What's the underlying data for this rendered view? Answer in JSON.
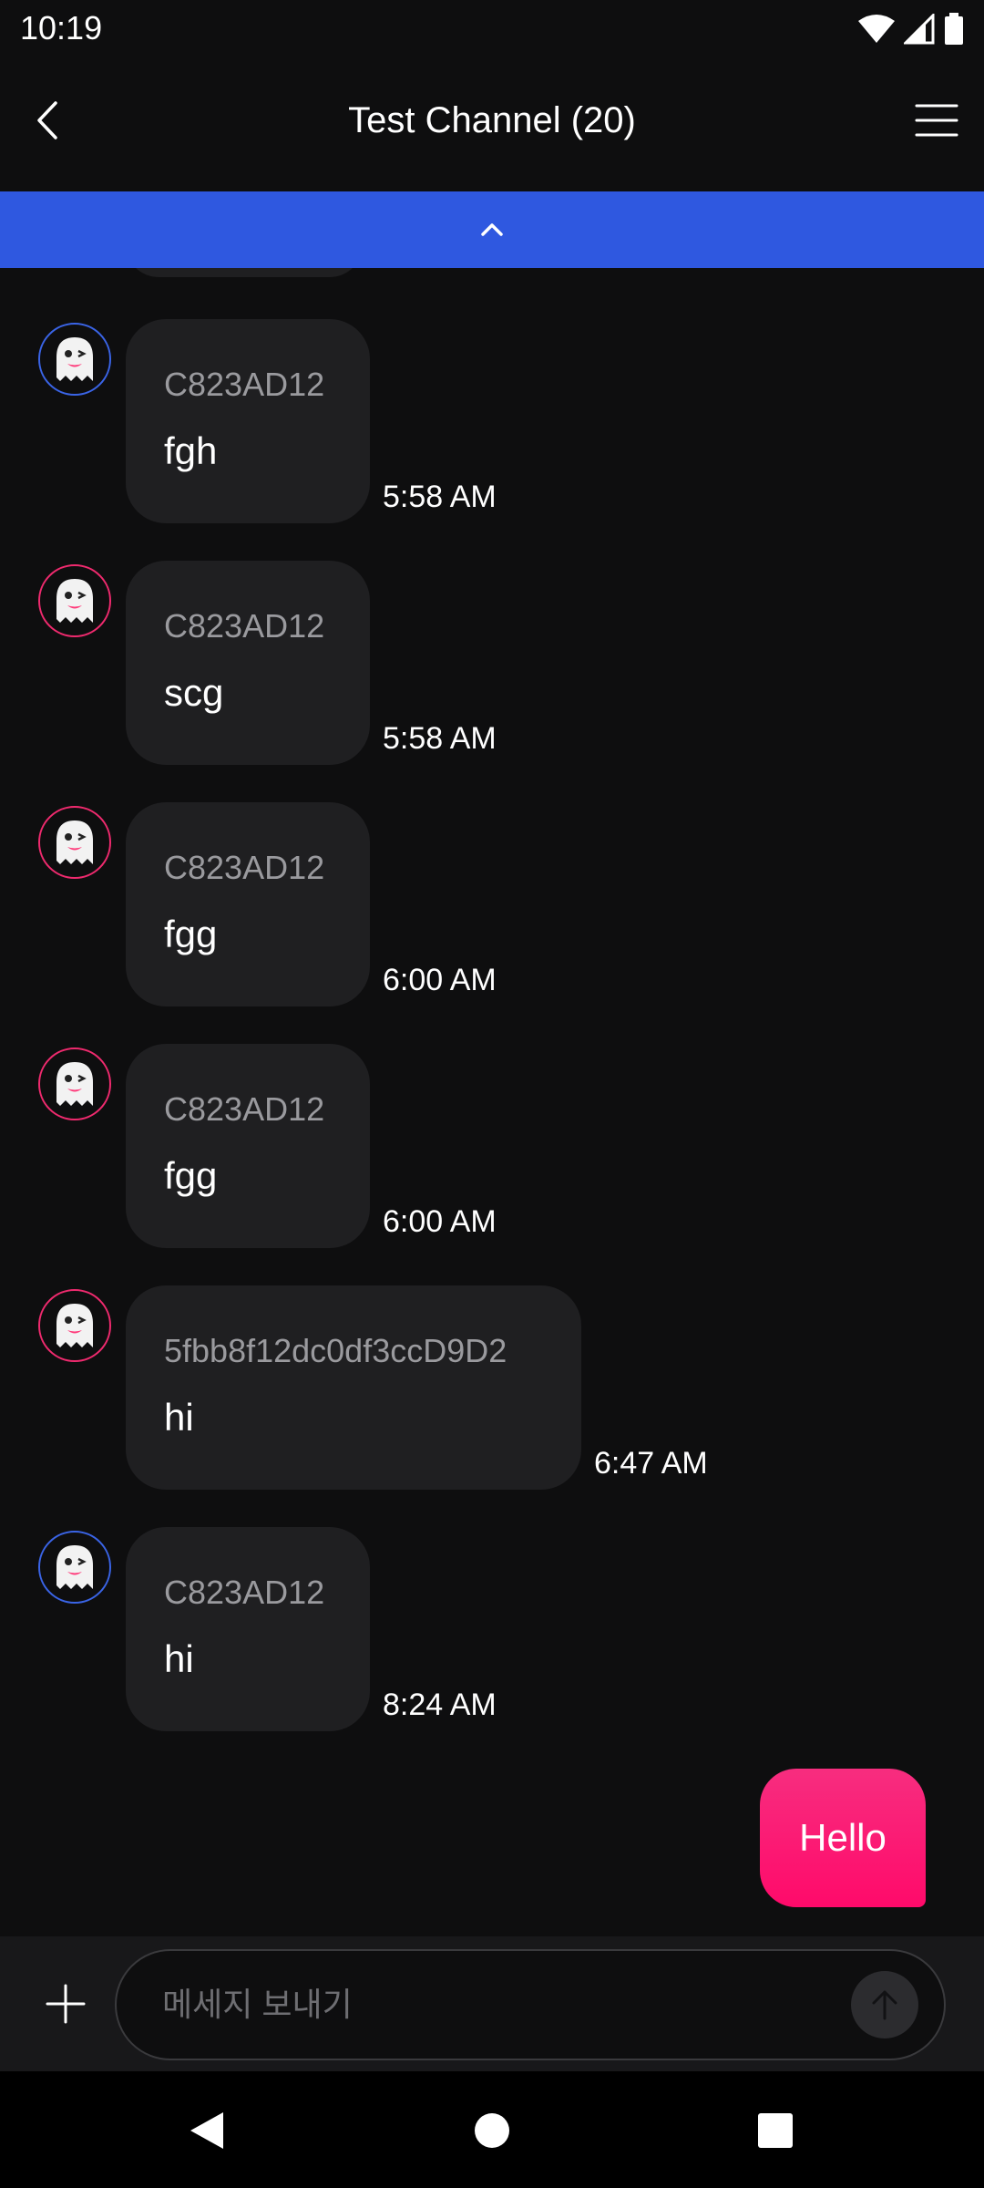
{
  "status_bar": {
    "time": "10:19",
    "icons": [
      "wifi-icon",
      "signal-icon",
      "battery-icon"
    ]
  },
  "header": {
    "title": "Test Channel (20)",
    "back_icon": "chevron-left-icon",
    "menu_icon": "hamburger-menu-icon"
  },
  "banner": {
    "icon": "chevron-up-icon",
    "color": "#2f58e0"
  },
  "messages": [
    {
      "sender": "C823AD12",
      "text": "fgh",
      "time": "5:58 AM",
      "avatar_ring": "blue"
    },
    {
      "sender": "C823AD12",
      "text": "scg",
      "time": "5:58 AM",
      "avatar_ring": "pink"
    },
    {
      "sender": "C823AD12",
      "text": "fgg",
      "time": "6:00 AM",
      "avatar_ring": "pink"
    },
    {
      "sender": "C823AD12",
      "text": "fgg",
      "time": "6:00 AM",
      "avatar_ring": "pink"
    },
    {
      "sender": "5fbb8f12dc0df3ccD9D2",
      "text": "hi",
      "time": "6:47 AM",
      "avatar_ring": "pink"
    },
    {
      "sender": "C823AD12",
      "text": "hi",
      "time": "8:24 AM",
      "avatar_ring": "blue"
    }
  ],
  "avatar_icon": "ghost-icon",
  "outgoing": {
    "text": "Hello",
    "color": "#ff0a6a"
  },
  "composer": {
    "placeholder": "메세지 보내기",
    "value": "",
    "plus_icon": "plus-icon",
    "send_icon": "arrow-up-icon"
  },
  "nav": {
    "icons": [
      "back-triangle-icon",
      "home-circle-icon",
      "recents-square-icon"
    ]
  },
  "colors": {
    "background": "#0e0e0f",
    "bubble": "#1f1f21",
    "accent_blue": "#3a64e6",
    "accent_pink": "#ef2a6e"
  }
}
